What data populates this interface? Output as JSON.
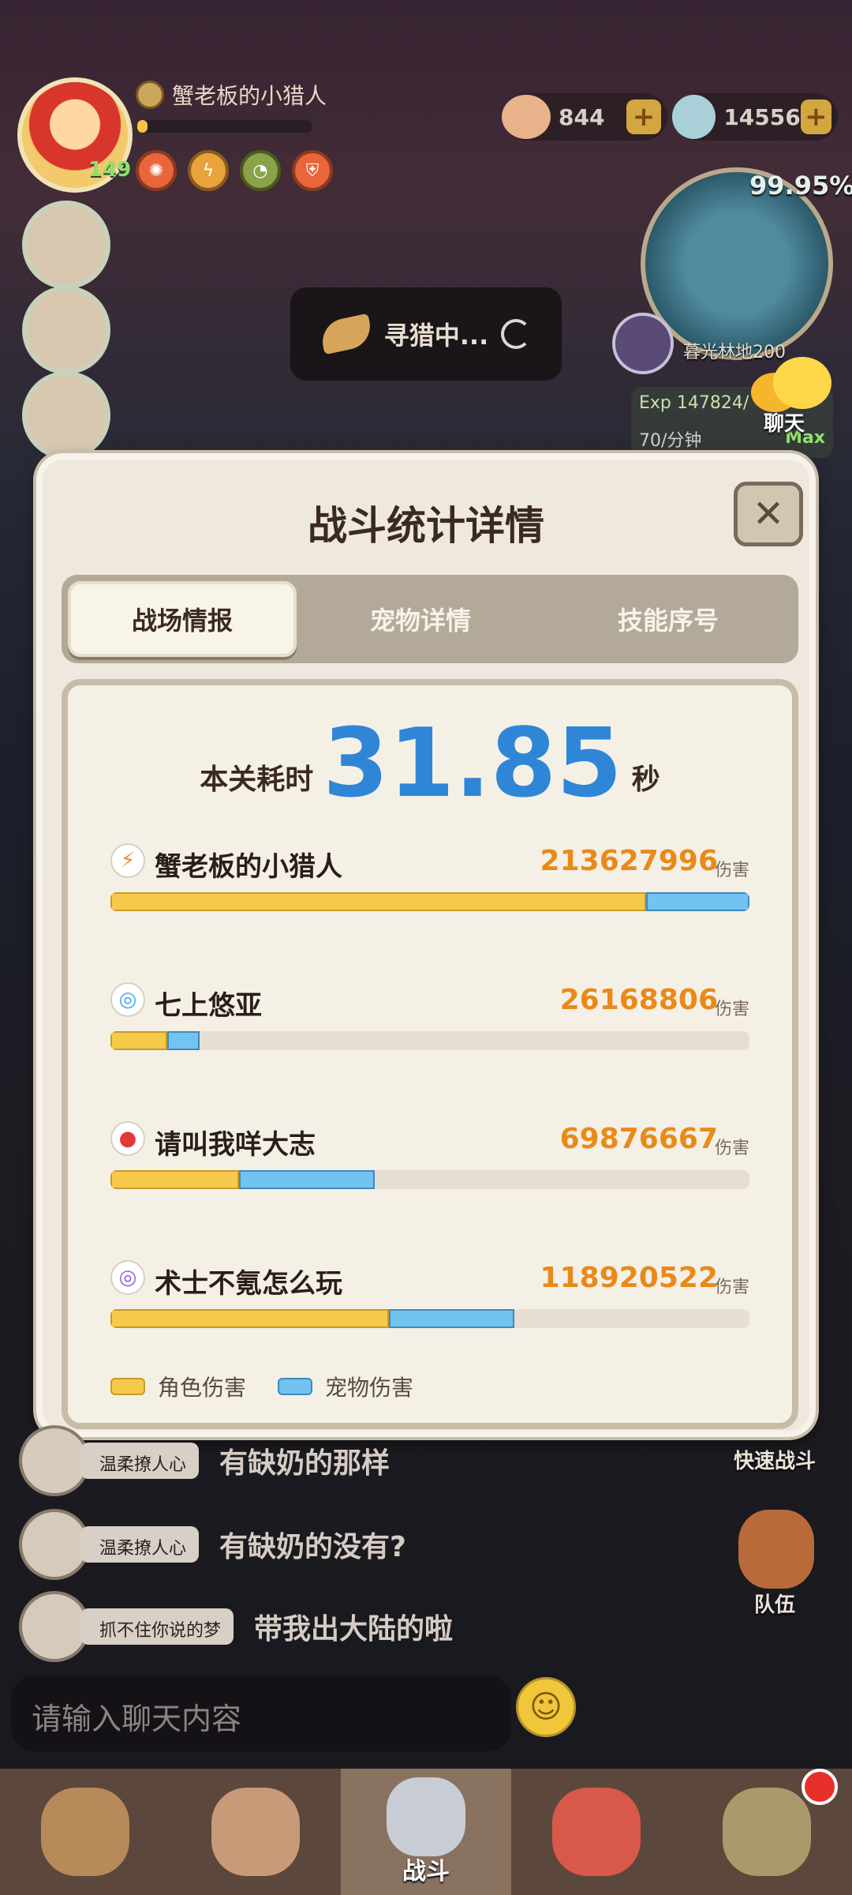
{
  "player_hud": {
    "name": "蟹老板的小猎人",
    "level": "149"
  },
  "currencies": [
    {
      "icon": "shell-icon",
      "value": "844"
    },
    {
      "icon": "stone-icon",
      "value": "14556"
    }
  ],
  "map": {
    "percent": "99.95%",
    "area": "暮光林地200"
  },
  "exp_panel": {
    "exp": "Exp 147824/",
    "rate": "70/分钟",
    "max": "Max"
  },
  "chat_button": {
    "label": "聊天"
  },
  "hunting": {
    "label": "寻猎中..."
  },
  "dialog": {
    "title": "战斗统计详情",
    "tabs": [
      "战场情报",
      "宠物详情",
      "技能序号"
    ],
    "active_tab": 0,
    "time_label": "本关耗时",
    "time_value": "31.85",
    "time_unit": "秒",
    "damage_unit": "伤害",
    "players": [
      {
        "name": "蟹老板的小猎人",
        "icon": "fire-claw-icon",
        "icon_color": "#f08a2a",
        "damage": "213627996",
        "char_fraction": 0.838,
        "pet_fraction": 0.162
      },
      {
        "name": "七上悠亚",
        "icon": "water-swirl-icon",
        "icon_color": "#3aa6e8",
        "damage": "26168806",
        "char_fraction": 0.089,
        "pet_fraction": 0.051
      },
      {
        "name": "请叫我咩大志",
        "icon": "red-orb-icon",
        "icon_color": "#e23a3a",
        "damage": "69876667",
        "char_fraction": 0.201,
        "pet_fraction": 0.212
      },
      {
        "name": "术士不氪怎么玩",
        "icon": "purple-swirl-icon",
        "icon_color": "#9a5ad8",
        "damage": "118920522",
        "char_fraction": 0.436,
        "pet_fraction": 0.196
      }
    ],
    "legend": {
      "char": "角色伤害",
      "pet": "宠物伤害"
    }
  },
  "chat_messages": [
    {
      "sender": "温柔撩人心",
      "text": "有缺奶的那样"
    },
    {
      "sender": "温柔撩人心",
      "text": "有缺奶的没有?"
    },
    {
      "sender": "抓不住你说的梦",
      "text": "带我出大陆的啦"
    }
  ],
  "side_buttons": {
    "quick_battle": "快速战斗",
    "team": "队伍"
  },
  "chat_input": {
    "placeholder": "请输入聊天内容"
  },
  "bottom_nav": {
    "active_label": "战斗"
  },
  "colors": {
    "char_damage": "#f6c94a",
    "pet_damage": "#72c3ef",
    "time_value": "#2f86d6",
    "damage_number": "#e88a1a"
  }
}
